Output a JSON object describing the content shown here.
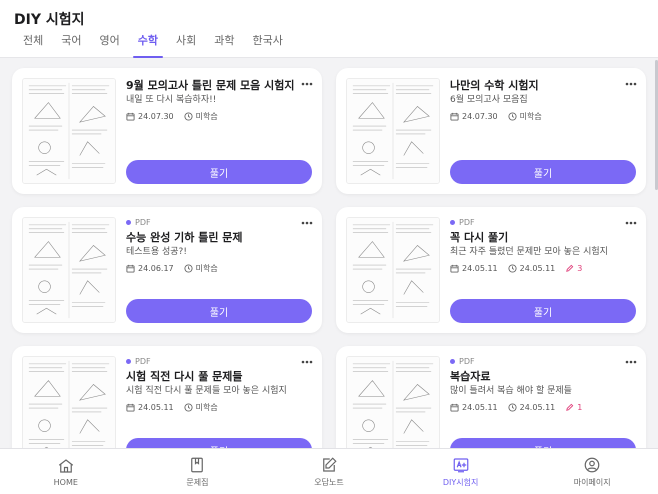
{
  "app": {
    "title": "DIY 시험지"
  },
  "tabs": [
    {
      "label": "전체",
      "active": false
    },
    {
      "label": "국어",
      "active": false
    },
    {
      "label": "영어",
      "active": false
    },
    {
      "label": "수학",
      "active": true
    },
    {
      "label": "사회",
      "active": false
    },
    {
      "label": "과학",
      "active": false
    },
    {
      "label": "한국사",
      "active": false
    }
  ],
  "cards": [
    {
      "type": "",
      "title": "9월 모의고사 틀린 문제 모음 시험지",
      "subtitle": "내일 또 다시 복습하자!!",
      "date": "24.07.30",
      "progress": "미학습",
      "edits": "",
      "button": "풀기"
    },
    {
      "type": "",
      "title": "나만의 수학 시험지",
      "subtitle": "6월 모의고사 모음집",
      "date": "24.07.30",
      "progress": "미학습",
      "edits": "",
      "button": "풀기"
    },
    {
      "type": "PDF",
      "title": "수능 완성 기하 틀린 문제",
      "subtitle": "테스트용 성공?!",
      "date": "24.06.17",
      "progress": "미학습",
      "edits": "",
      "button": "풀기"
    },
    {
      "type": "PDF",
      "title": "꼭 다시 풀기",
      "subtitle": "최근 자주 틀렸던 문제만 모아 놓은 시험지",
      "date": "24.05.11",
      "progress": "24.05.11",
      "edits": "3",
      "button": "풀기"
    },
    {
      "type": "PDF",
      "title": "시험 직전 다시 풀 문제들",
      "subtitle": "시험 직전 다시 풀 문제들 모아 놓은 시험지",
      "date": "24.05.11",
      "progress": "미학습",
      "edits": "",
      "button": "풀기"
    },
    {
      "type": "PDF",
      "title": "복습자료",
      "subtitle": "많이 틀려서 복습 해야 할 문제들",
      "date": "24.05.11",
      "progress": "24.05.11",
      "edits": "1",
      "button": "풀기"
    }
  ],
  "bottom_nav": [
    {
      "label": "HOME",
      "icon": "home-icon",
      "active": false
    },
    {
      "label": "문제집",
      "icon": "book-icon",
      "active": false
    },
    {
      "label": "오답노트",
      "icon": "edit-note-icon",
      "active": false
    },
    {
      "label": "DIY시험지",
      "icon": "diy-exam-icon",
      "active": true
    },
    {
      "label": "마이페이지",
      "icon": "user-icon",
      "active": false
    }
  ],
  "colors": {
    "accent": "#7b69f5",
    "accent_text": "#6f5ef0",
    "edit_count": "#e0407b",
    "background": "#f3f3f5"
  }
}
